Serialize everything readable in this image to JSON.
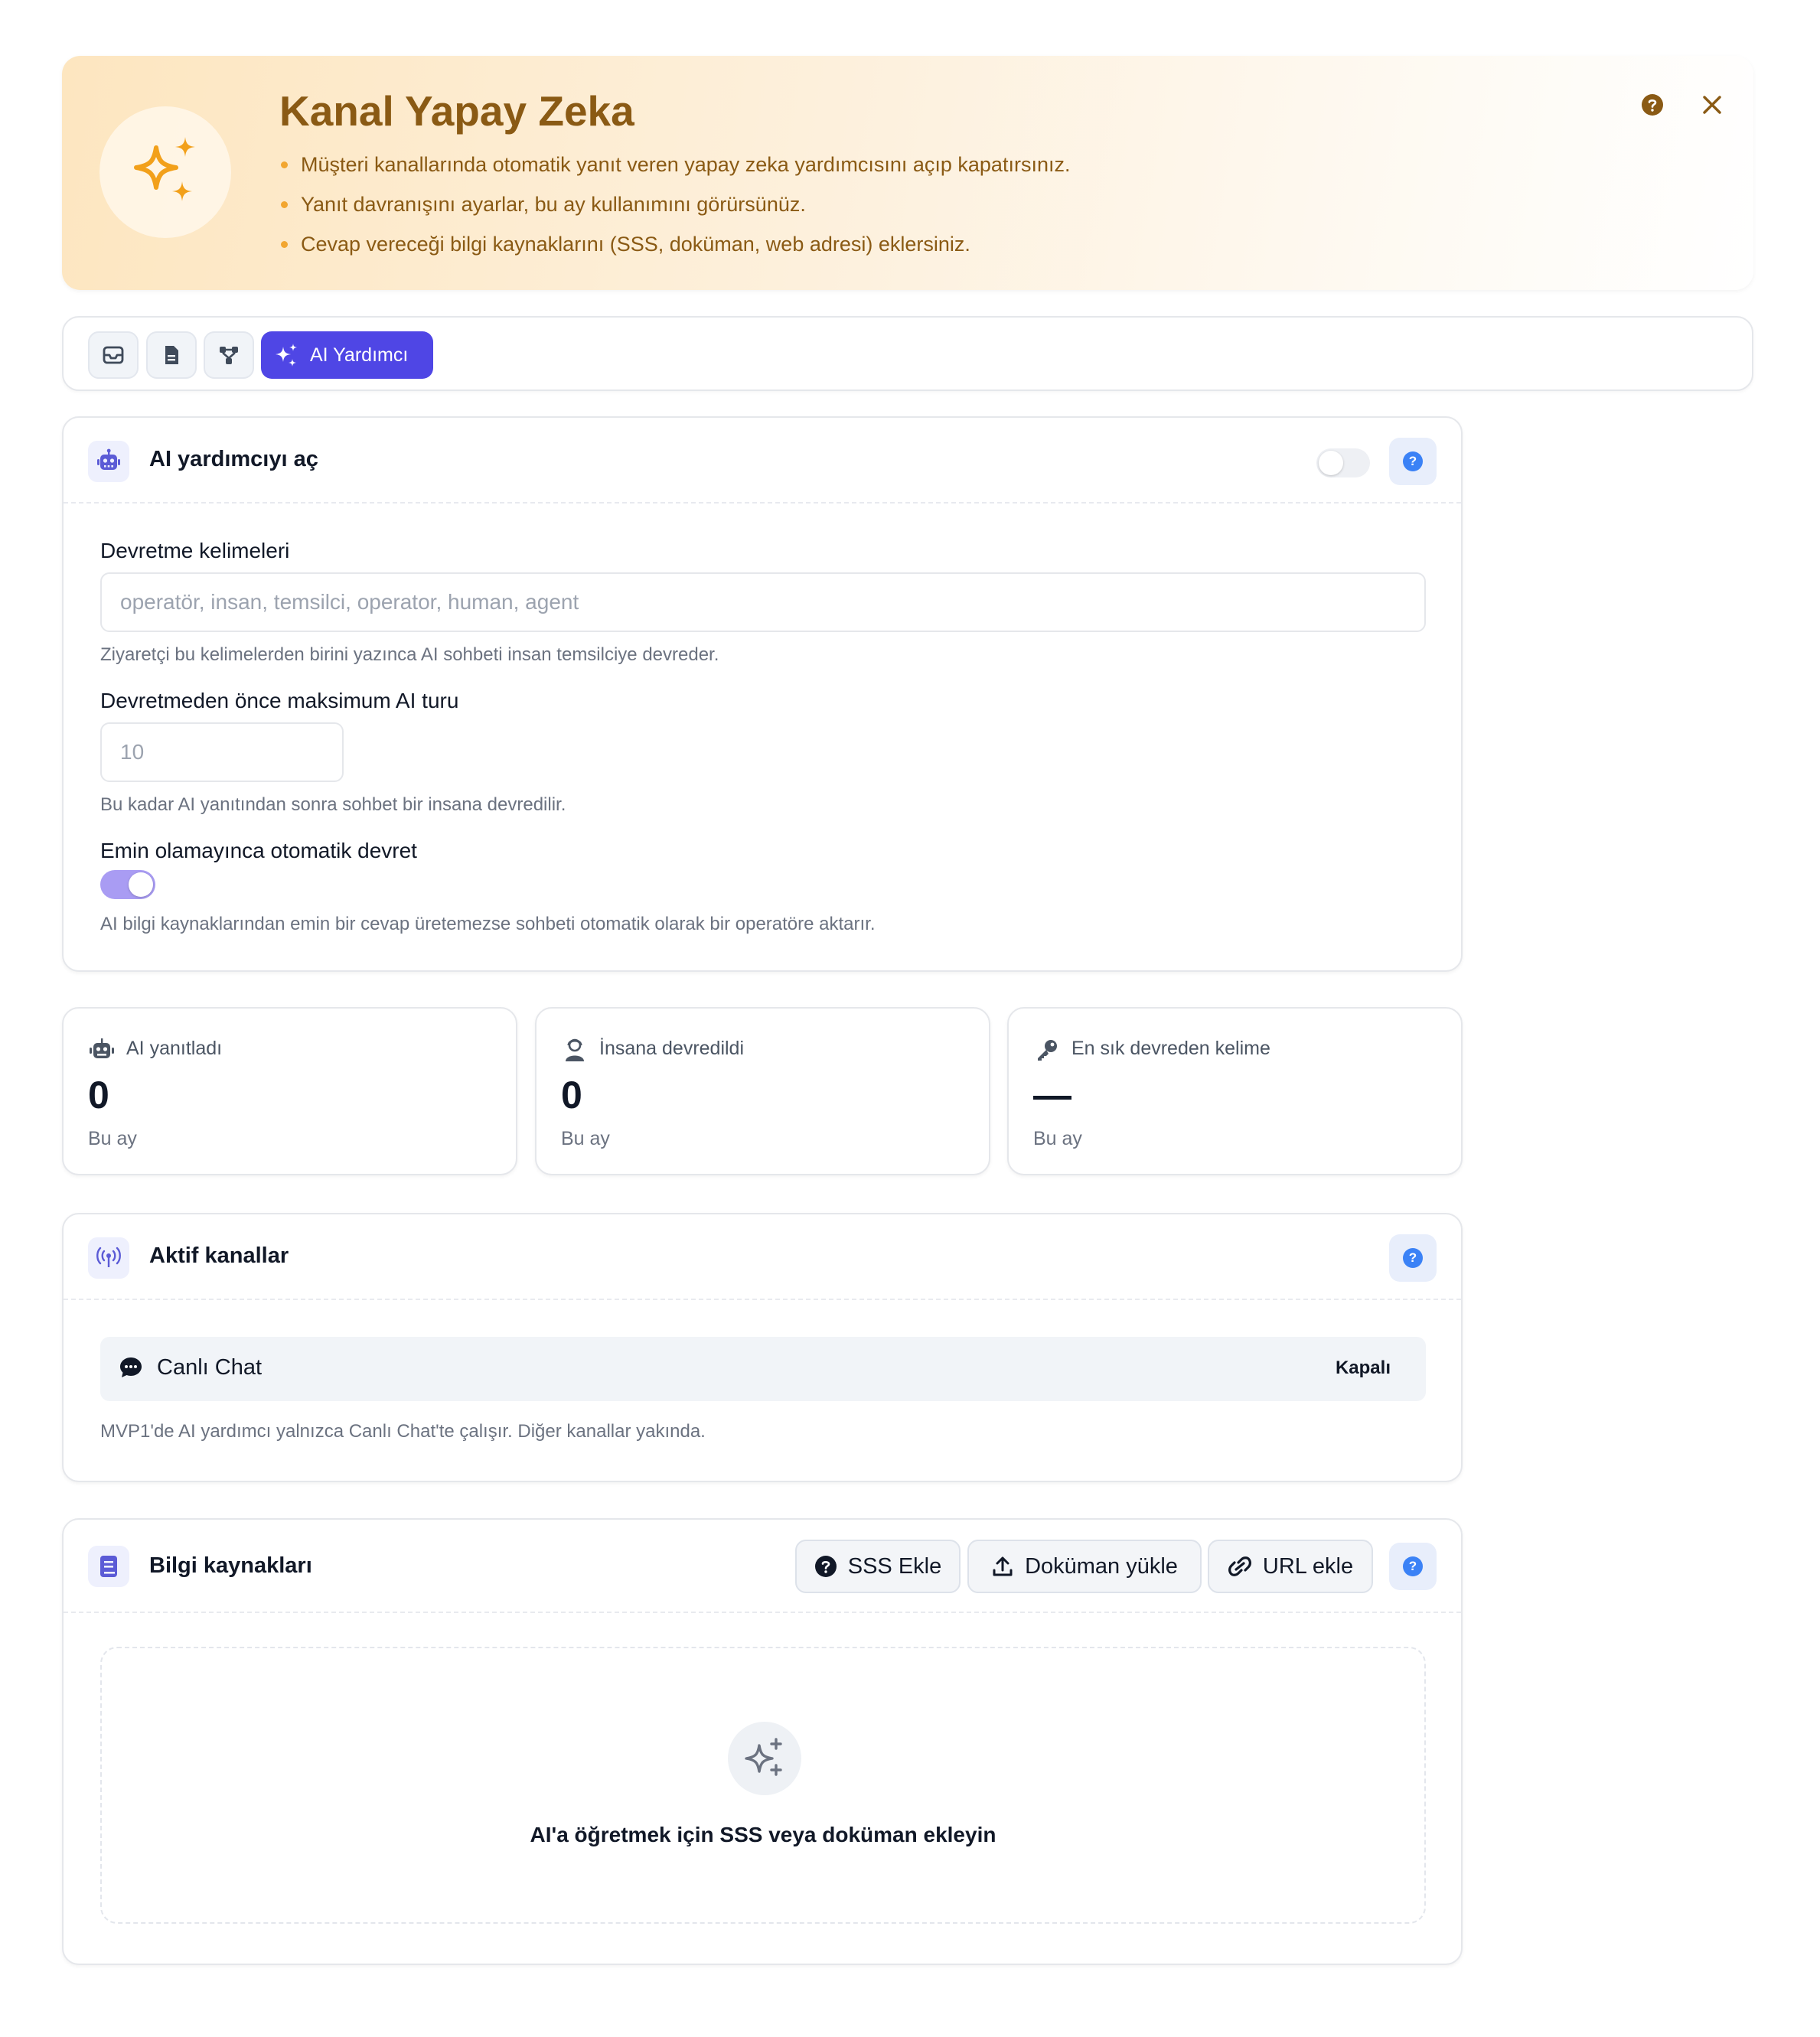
{
  "banner": {
    "title": "Kanal Yapay Zeka",
    "bullets": [
      "Müşteri kanallarında otomatik yanıt veren yapay zeka yardımcısını açıp kapatırsınız.",
      "Yanıt davranışını ayarlar, bu ay kullanımını görürsünüz.",
      "Cevap vereceği bilgi kaynaklarını (SSS, doküman, web adresi) eklersiniz."
    ],
    "icons": {
      "badge": "sparkles-icon",
      "help": "help-circle-icon",
      "close": "close-icon"
    }
  },
  "tabs": {
    "icon_tabs": [
      "inbox-icon",
      "document-icon",
      "flow-icon"
    ],
    "active_label": "AI Yardımcı"
  },
  "ai_settings": {
    "title": "AI yardımcıyı aç",
    "enabled": false,
    "handoff_words": {
      "label": "Devretme kelimeleri",
      "placeholder": "operatör, insan, temsilci, operator, human, agent",
      "hint": "Ziyaretçi bu kelimelerden birini yazınca AI sohbeti insan temsilciye devreder."
    },
    "max_turns": {
      "label": "Devretmeden önce maksimum AI turu",
      "placeholder": "10",
      "hint": "Bu kadar AI yanıtından sonra sohbet bir insana devredilir."
    },
    "auto_handoff": {
      "label": "Emin olamayınca otomatik devret",
      "enabled": true,
      "hint": "AI bilgi kaynaklarından emin bir cevap üretemezse sohbeti otomatik olarak bir operatöre aktarır."
    }
  },
  "stats": [
    {
      "icon": "robot-icon",
      "label": "AI yanıtladı",
      "value": "0",
      "sub": "Bu ay"
    },
    {
      "icon": "agent-icon",
      "label": "İnsana devredildi",
      "value": "0",
      "sub": "Bu ay"
    },
    {
      "icon": "key-icon",
      "label": "En sık devreden kelime",
      "value": "—",
      "sub": "Bu ay"
    }
  ],
  "channels": {
    "title": "Aktif kanallar",
    "items": [
      {
        "name": "Canlı Chat",
        "status": "Kapalı"
      }
    ],
    "note": "MVP1'de AI yardımcı yalnızca Canlı Chat'te çalışır. Diğer kanallar yakında."
  },
  "knowledge": {
    "title": "Bilgi kaynakları",
    "actions": {
      "faq": "SSS Ekle",
      "upload": "Doküman yükle",
      "url": "URL ekle"
    },
    "empty_text": "AI'a öğretmek için SSS veya doküman ekleyin"
  },
  "colors": {
    "accent": "#4f46e5",
    "banner_text": "#8a5a14",
    "banner_dot": "#f2a630",
    "help_blue": "#3b82f6"
  }
}
